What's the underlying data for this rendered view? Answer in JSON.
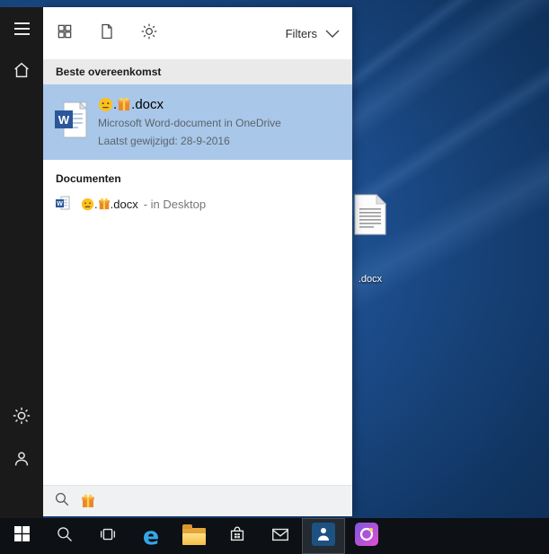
{
  "colors": {
    "highlight": "#a9c7e8",
    "section_header_bg": "#eaeaea",
    "panel_bg": "#ffffff",
    "rail_bg": "#1a1a1a",
    "taskbar_bg": "#0d1014",
    "word_blue": "#2b579a"
  },
  "panel": {
    "toolbar": {
      "filters_label": "Filters",
      "icons": [
        "apps-icon",
        "document-icon",
        "settings-gear-icon"
      ]
    },
    "best_match": {
      "header": "Beste overeenkomst",
      "file": {
        "name_full": "😐.🎁.docx",
        "sep": ".",
        "ext": ".docx",
        "type_line": "Microsoft Word-document in OneDrive",
        "modified_line": "Laatst gewijzigd: 28-9-2016"
      }
    },
    "documents": {
      "header": "Documenten",
      "item": {
        "name_full": "😐.🎁.docx",
        "sep": ".",
        "ext": ".docx",
        "location_suffix": "- in Desktop"
      }
    },
    "search": {
      "query": "🎁",
      "query_icon": "gift-emoji"
    }
  },
  "desktop": {
    "icon_label": ".docx"
  },
  "taskbar": {
    "icons": [
      "windows-logo",
      "search",
      "task-view",
      "edge",
      "file-explorer",
      "store",
      "mail",
      "active-app",
      "paint-3d"
    ],
    "edge_glyph": "e"
  }
}
